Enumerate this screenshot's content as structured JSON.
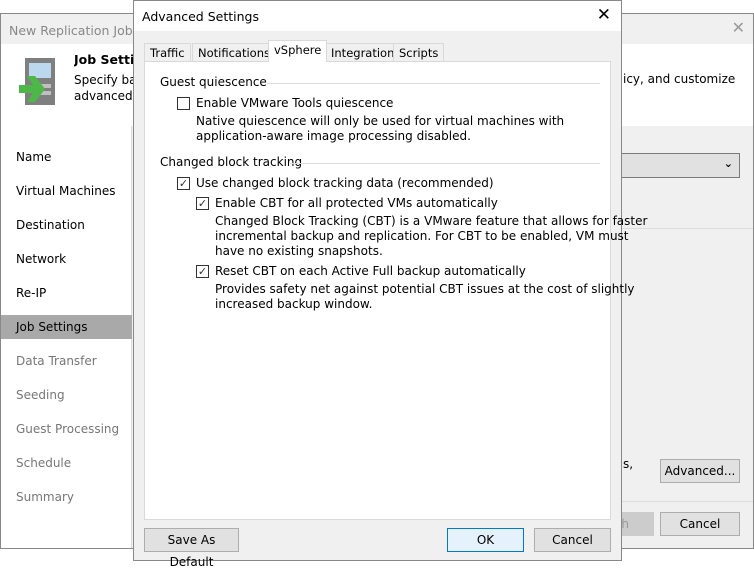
{
  "background_window": {
    "title": "New Replication Job",
    "header_title": "Job Settings",
    "header_desc_left": "Specify backup\nadvanced job",
    "header_desc_right": "icy, and customize",
    "nav": [
      {
        "label": "Name",
        "state": "normal"
      },
      {
        "label": "Virtual Machines",
        "state": "normal"
      },
      {
        "label": "Destination",
        "state": "normal"
      },
      {
        "label": "Network",
        "state": "normal"
      },
      {
        "label": "Re-IP",
        "state": "normal"
      },
      {
        "label": "Job Settings",
        "state": "selected"
      },
      {
        "label": "Data Transfer",
        "state": "disabled"
      },
      {
        "label": "Seeding",
        "state": "disabled"
      },
      {
        "label": "Guest Processing",
        "state": "disabled"
      },
      {
        "label": "Schedule",
        "state": "disabled"
      },
      {
        "label": "Summary",
        "state": "disabled"
      }
    ],
    "partial_text": "s,",
    "advanced_label": "Advanced...",
    "finish_label": "h",
    "cancel_label": "Cancel"
  },
  "dialog": {
    "title": "Advanced Settings",
    "tabs": [
      "Traffic",
      "Notifications",
      "vSphere",
      "Integration",
      "Scripts"
    ],
    "active_tab": "vSphere",
    "guest_quiescence": {
      "heading": "Guest quiescence",
      "checkbox_label": "Enable VMware Tools quiescence",
      "checked": false,
      "desc": "Native quiescence will only be used for virtual machines with\napplication-aware image processing disabled."
    },
    "cbt": {
      "heading": "Changed block tracking",
      "use_label": "Use changed block tracking data (recommended)",
      "use_checked": true,
      "enable_label": "Enable CBT for all protected VMs automatically",
      "enable_checked": true,
      "enable_desc": "Changed Block Tracking (CBT) is a VMware feature that allows for faster\nincremental backup and replication. For CBT to be enabled, VM must\nhave no existing snapshots.",
      "reset_label": "Reset CBT on each Active Full backup automatically",
      "reset_checked": true,
      "reset_desc": "Provides safety net against potential CBT issues at the cost of slightly\nincreased backup window."
    },
    "save_default_label": "Save As Default",
    "ok_label": "OK",
    "cancel_label": "Cancel",
    "check_mark": "✓",
    "close_glyph": "✕"
  }
}
